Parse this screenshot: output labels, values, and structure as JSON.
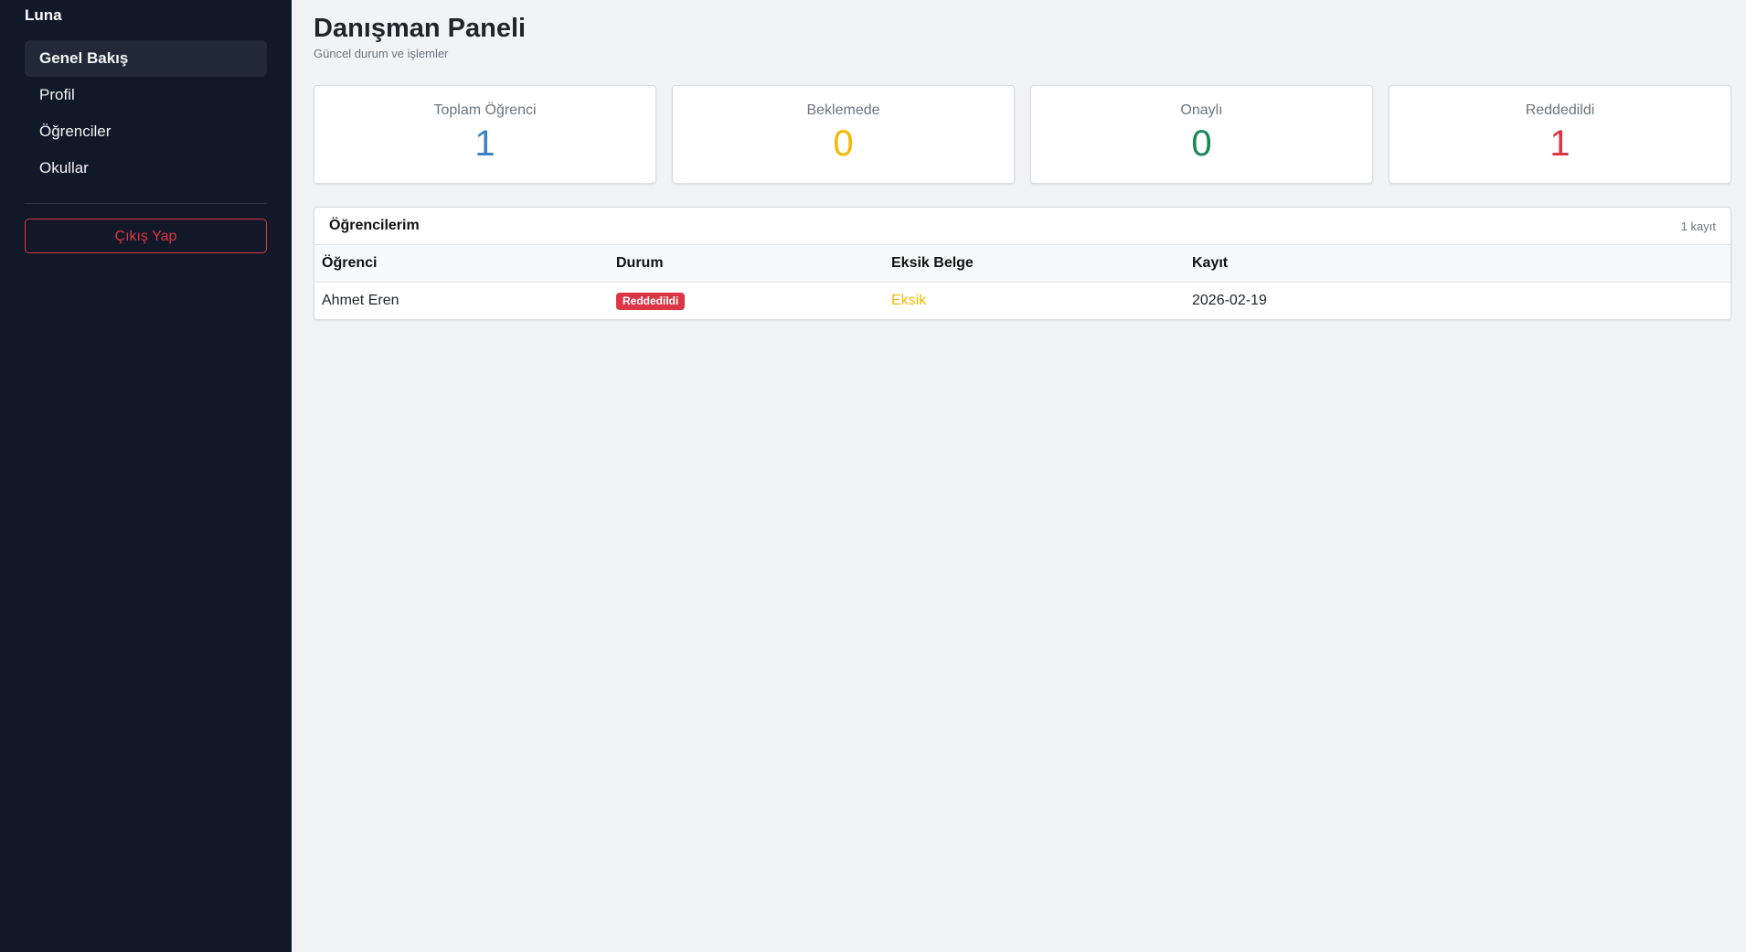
{
  "app": {
    "brand": "Luna"
  },
  "sidebar": {
    "items": [
      {
        "label": "Genel Bakış",
        "active": true
      },
      {
        "label": "Profil",
        "active": false
      },
      {
        "label": "Öğrenciler",
        "active": false
      },
      {
        "label": "Okullar",
        "active": false
      }
    ],
    "logout_label": "Çıkış Yap"
  },
  "header": {
    "title": "Danışman Paneli",
    "subtitle": "Güncel durum ve işlemler"
  },
  "stats": [
    {
      "label": "Toplam Öğrenci",
      "value": "1",
      "color": "#3b82c4"
    },
    {
      "label": "Beklemede",
      "value": "0",
      "color": "#f4b800"
    },
    {
      "label": "Onaylı",
      "value": "0",
      "color": "#198754"
    },
    {
      "label": "Reddedildi",
      "value": "1",
      "color": "#dc3545"
    }
  ],
  "students_panel": {
    "title": "Öğrencilerim",
    "count": "1 kayıt",
    "columns": [
      "Öğrenci",
      "Durum",
      "Eksik Belge",
      "Kayıt"
    ],
    "rows": [
      {
        "student": "Ahmet Eren",
        "status": "Reddedildi",
        "status_color": "#dc3545",
        "missing_doc": "Eksik",
        "missing_color": "#f4b800",
        "registered": "2026-02-19"
      }
    ]
  }
}
